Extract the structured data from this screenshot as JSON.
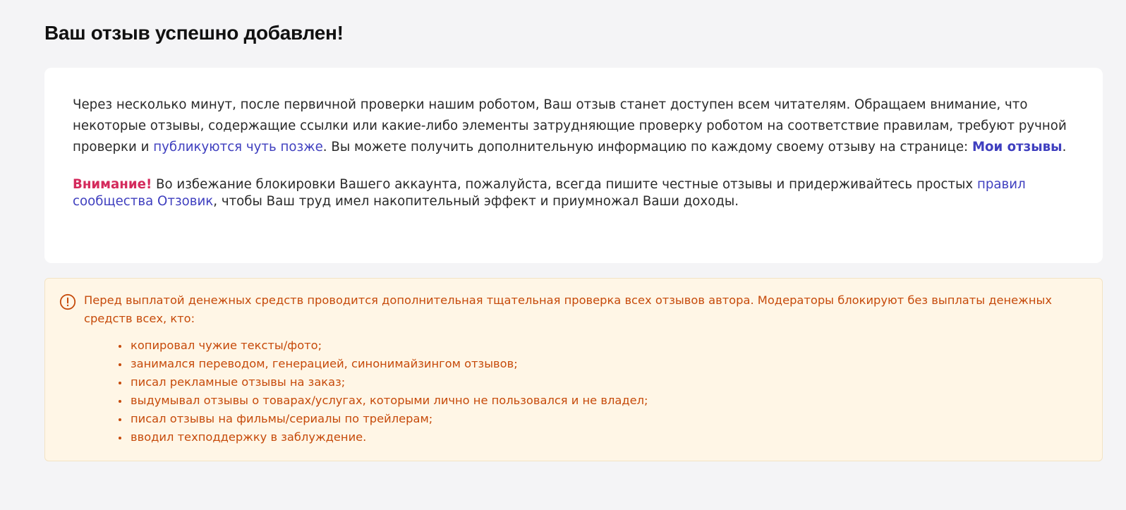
{
  "page": {
    "title": "Ваш отзыв успешно добавлен!"
  },
  "info": {
    "text_part1": "Через несколько минут, после первичной проверки нашим роботом, Ваш отзыв станет доступен всем читателям. Обращаем внимание, что некоторые отзывы, содержащие ссылки или какие-либо элементы затрудняющие проверку роботом на соответствие правилам, требуют ручной проверки и ",
    "later_link": "публикуются чуть позже",
    "text_part2": ". Вы можете получить дополнительную информацию по каждому своему отзыву на странице: ",
    "my_reviews_link": "Мои отзывы",
    "text_part3": ".",
    "warning_label": "Внимание!",
    "warning_text": " Во избежание блокировки Вашего аккаунта, пожалуйста, всегда пишите честные отзывы и придерживайтесь простых ",
    "rules_link": "правил сообщества Отзовик",
    "warning_text2": ", чтобы Ваш труд имел накопительный эффект и приумножал Ваши доходы."
  },
  "notice": {
    "icon": "exclamation-circle-icon",
    "color": "#c64a0a",
    "background": "#fff6e6",
    "text": "Перед выплатой денежных средств проводится дополнительная тщательная проверка всех отзывов автора. Модераторы блокируют без выплаты денежных средств всех, кто:",
    "items": [
      "копировал чужие тексты/фото;",
      "занимался переводом, генерацией, синонимайзингом отзывов;",
      "писал рекламные отзывы на заказ;",
      "выдумывал отзывы о товарах/услугах, которыми лично не пользовался и не владел;",
      "писал отзывы на фильмы/сериалы по трейлерам;",
      "вводил техподдержку в заблуждение."
    ]
  },
  "colors": {
    "link": "#3f3fbf",
    "warning": "#d42a5c"
  }
}
